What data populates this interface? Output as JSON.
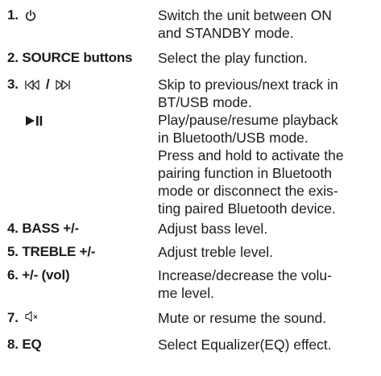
{
  "rows": [
    {
      "key_num": "1.",
      "key_text": "",
      "icon": "power-icon",
      "desc_lines": [
        "Switch the unit between ON",
        "and STANDBY mode."
      ]
    },
    {
      "key_num": "2.",
      "key_text": "SOURCE buttons",
      "icon": "",
      "desc_lines": [
        "Select the play function."
      ]
    },
    {
      "key_num": "3.",
      "key_text": "/",
      "icon": "skip-prev-next-icons",
      "desc_lines": [
        "Skip to previous/next track in",
        "BT/USB mode."
      ]
    },
    {
      "key_num": "",
      "key_text": "",
      "icon": "play-pause-icon",
      "desc_lines": [
        "Play/pause/resume  playback",
        "in Bluetooth/USB mode.",
        "Press and hold to activate the",
        "pairing function in Bluetooth",
        "mode or disconnect the exis-",
        "ting paired Bluetooth device."
      ]
    },
    {
      "key_num": "4.",
      "key_text": "BASS +/-",
      "icon": "",
      "desc_lines": [
        "Adjust bass level."
      ]
    },
    {
      "key_num": "5.",
      "key_text": "TREBLE +/-",
      "icon": "",
      "desc_lines": [
        "Adjust treble level."
      ]
    },
    {
      "key_num": "6.",
      "key_text": "+/- (vol)",
      "icon": "",
      "desc_lines": [
        "Increase/decrease  the  volu-",
        "me level."
      ]
    },
    {
      "key_num": "7.",
      "key_text": "",
      "icon": "mute-icon",
      "desc_lines": [
        "Mute or resume the sound."
      ]
    },
    {
      "key_num": "8.",
      "key_text": "EQ",
      "icon": "",
      "desc_lines": [
        "Select Equalizer(EQ) effect."
      ]
    }
  ]
}
